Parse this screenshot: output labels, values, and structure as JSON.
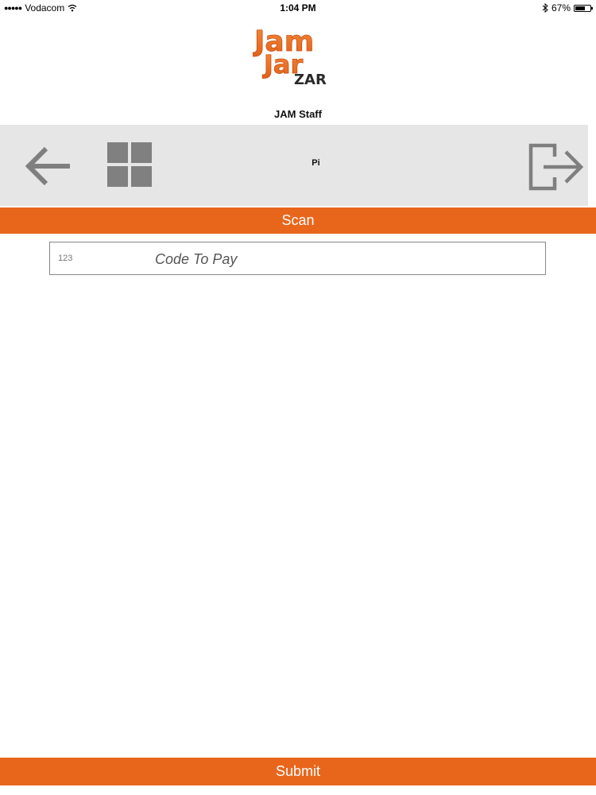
{
  "status_bar": {
    "carrier": "Vodacom",
    "time": "1:04 PM",
    "battery": "67%",
    "battery_level": 0.67,
    "signal_icon": "signal-dots-icon",
    "wifi_icon": "wifi-icon",
    "bluetooth_icon": "bluetooth-icon"
  },
  "logo": {
    "line1": "Jam",
    "line2": "Jar",
    "line3": "ZAR"
  },
  "header": {
    "user_label": "JAM Staff"
  },
  "toolbar": {
    "back_icon": "arrow-left-icon",
    "menu_icon": "grid-icon",
    "label": "Pi",
    "logout_icon": "logout-icon"
  },
  "scan_button": {
    "label": "Scan"
  },
  "code_field": {
    "prefix": "123",
    "placeholder": "Code To Pay",
    "value": ""
  },
  "submit_button": {
    "label": "Submit"
  },
  "colors": {
    "accent": "#e8661c",
    "toolbar_bg": "#e6e6e6",
    "icon_gray": "#808080"
  }
}
